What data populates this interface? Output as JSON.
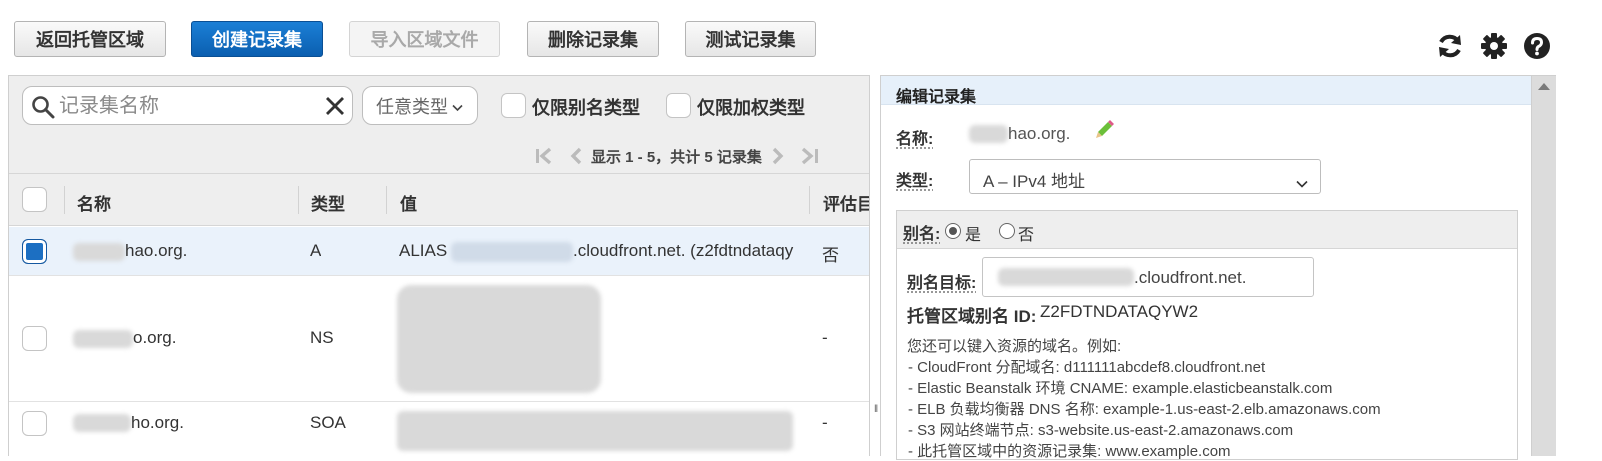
{
  "toolbar": {
    "back_label": "返回托管区域",
    "create_label": "创建记录集",
    "import_label": "导入区域文件",
    "delete_label": "删除记录集",
    "test_label": "测试记录集"
  },
  "filters": {
    "search_placeholder": "记录集名称",
    "type_select_value": "任意类型",
    "alias_only_label": "仅限别名类型",
    "weighted_only_label": "仅限加权类型"
  },
  "pager": {
    "text": "显示 1 - 5，共计 5 记录集"
  },
  "table": {
    "headers": {
      "name": "名称",
      "type": "类型",
      "value": "值",
      "eval": "评估目"
    },
    "rows": [
      {
        "name_suffix": "hao.org.",
        "type": "A",
        "value_prefix": "ALIAS",
        "value_suffix": ".cloudfront.net. (z2fdtndataqy",
        "eval": "否",
        "selected": true
      },
      {
        "name_suffix": "o.org.",
        "type": "NS",
        "eval": "-",
        "selected": false
      },
      {
        "name_suffix": "ho.org.",
        "type": "SOA",
        "eval": "-",
        "selected": false
      }
    ]
  },
  "editor": {
    "title": "编辑记录集",
    "name_label": "名称:",
    "name_suffix": "hao.org.",
    "type_label": "类型:",
    "type_value": "A – IPv4 地址",
    "alias_label": "别名:",
    "alias_yes": "是",
    "alias_no": "否",
    "alias_target_label": "别名目标:",
    "alias_target_suffix": ".cloudfront.net.",
    "hosted_zone_label": "托管区域别名 ID:",
    "hosted_zone_value": "Z2FDTNDATAQYW2",
    "help_intro": "您还可以键入资源的域名。例如:",
    "help_lines": [
      "-  CloudFront 分配域名: d111111abcdef8.cloudfront.net",
      "-  Elastic Beanstalk 环境 CNAME: example.elasticbeanstalk.com",
      "-  ELB 负载均衡器 DNS 名称: example-1.us-east-2.elb.amazonaws.com",
      "-  S3 网站终端节点: s3-website.us-east-2.amazonaws.com",
      "-  此托管区域中的资源记录集: www.example.com"
    ]
  },
  "colors": {
    "primary": "#0b5fb0",
    "selected_row": "#eaf2fb",
    "panel_title_bg": "#e6f0fa"
  }
}
